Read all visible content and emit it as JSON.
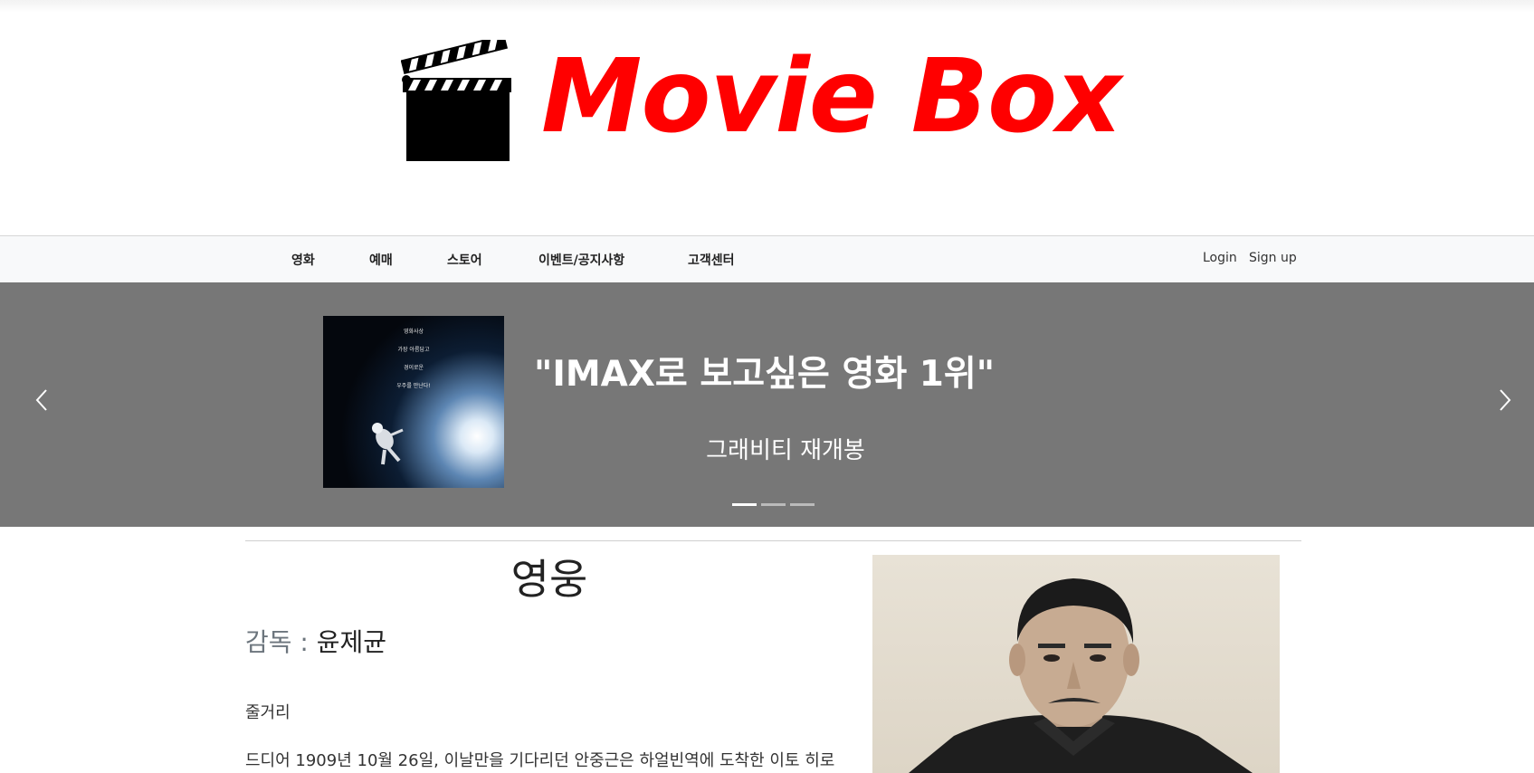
{
  "header": {
    "logo_text": "Movie Box",
    "logo_icon": "clapperboard-icon",
    "brand_color": "#ff0000"
  },
  "nav": {
    "items": [
      {
        "label": "영화"
      },
      {
        "label": "예매"
      },
      {
        "label": "스토어"
      },
      {
        "label": "이벤트/공지사항"
      },
      {
        "label": "고객센터"
      }
    ],
    "login": "Login",
    "signup": "Sign up"
  },
  "carousel": {
    "background": "#777777",
    "headline": "\"IMAX로 보고싶은 영화 1위\"",
    "caption": "그래비티 재개봉",
    "poster_lines": [
      "영화사상",
      "가장 아름답고",
      "경이로운",
      "우주를 만난다!"
    ],
    "prev_icon": "chevron-left-icon",
    "next_icon": "chevron-right-icon",
    "slide_count": 3,
    "active_slide": 1
  },
  "movie": {
    "title": "영웅",
    "director_label": "감독 : ",
    "director_name": "윤제균",
    "synopsis_heading": "줄거리",
    "synopsis_text": "드디어 1909년 10월 26일, 이날만을 기다리던 안중근은 하얼빈역에 도착한 이토 히로"
  }
}
